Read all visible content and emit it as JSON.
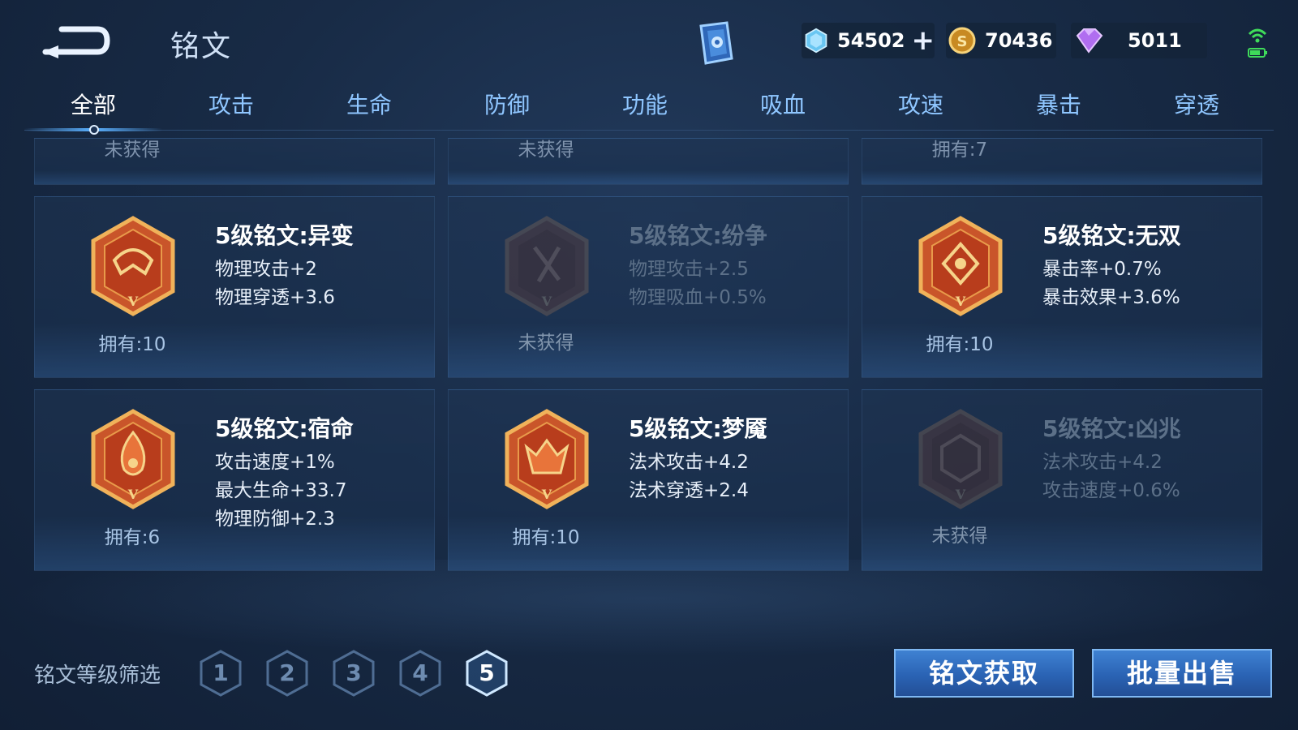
{
  "header": {
    "title": "铭文",
    "currencies": [
      {
        "icon": "crystal-icon",
        "value": "54502"
      },
      {
        "icon": "gold-coin-icon",
        "value": "70436"
      },
      {
        "icon": "diamond-icon",
        "value": "5011"
      }
    ]
  },
  "tabs": [
    "全部",
    "攻击",
    "生命",
    "防御",
    "功能",
    "吸血",
    "攻速",
    "暴击",
    "穿透"
  ],
  "active_tab": "全部",
  "top_row": [
    {
      "owned": "未获得"
    },
    {
      "owned": "未获得"
    },
    {
      "owned": "拥有:7"
    }
  ],
  "cards": [
    {
      "name": "5级铭文:异变",
      "stats": [
        "物理攻击+2",
        "物理穿透+3.6"
      ],
      "owned": "拥有:10",
      "locked": false,
      "color": "#d2451f"
    },
    {
      "name": "5级铭文:纷争",
      "stats": [
        "物理攻击+2.5",
        "物理吸血+0.5%"
      ],
      "owned": "未获得",
      "locked": true,
      "color": "#b8331c"
    },
    {
      "name": "5级铭文:无双",
      "stats": [
        "暴击率+0.7%",
        "暴击效果+3.6%"
      ],
      "owned": "拥有:10",
      "locked": false,
      "color": "#d2451f"
    },
    {
      "name": "5级铭文:宿命",
      "stats": [
        "攻击速度+1%",
        "最大生命+33.7",
        "物理防御+2.3"
      ],
      "owned": "拥有:6",
      "locked": false,
      "color": "#d2451f"
    },
    {
      "name": "5级铭文:梦魇",
      "stats": [
        "法术攻击+4.2",
        "法术穿透+2.4"
      ],
      "owned": "拥有:10",
      "locked": false,
      "color": "#d2451f"
    },
    {
      "name": "5级铭文:凶兆",
      "stats": [
        "法术攻击+4.2",
        "攻击速度+0.6%"
      ],
      "owned": "未获得",
      "locked": true,
      "color": "#b8331c"
    }
  ],
  "filter": {
    "label": "铭文等级筛选",
    "levels": [
      "1",
      "2",
      "3",
      "4",
      "5"
    ],
    "active_level": "5"
  },
  "buttons": {
    "obtain": "铭文获取",
    "sell": "批量出售"
  }
}
